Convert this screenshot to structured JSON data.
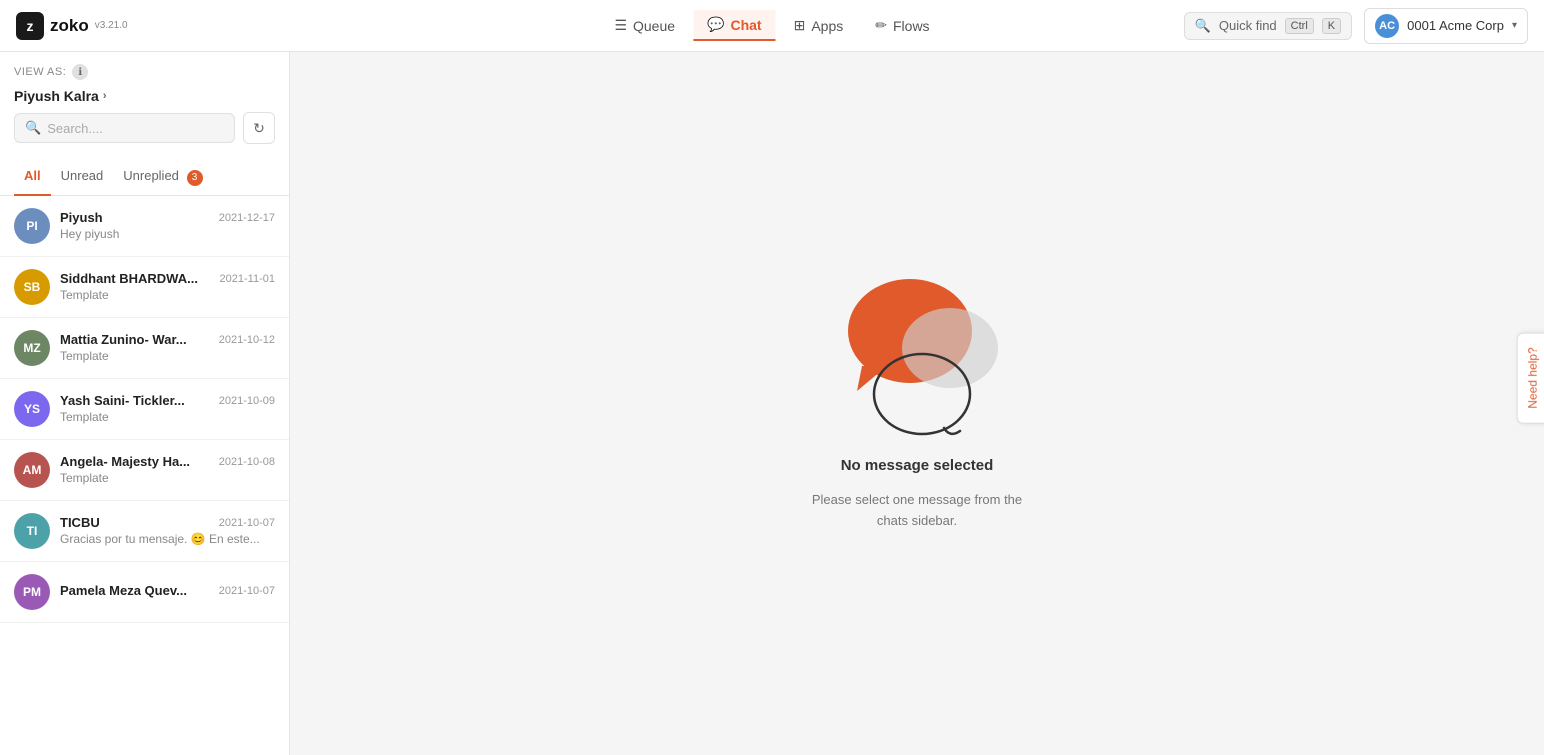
{
  "app": {
    "logo_text": "z",
    "logo_name": "zoko",
    "logo_version": "v3.21.0"
  },
  "nav": {
    "items": [
      {
        "id": "queue",
        "label": "Queue",
        "icon": "☰",
        "active": false
      },
      {
        "id": "chat",
        "label": "Chat",
        "icon": "💬",
        "active": true
      },
      {
        "id": "apps",
        "label": "Apps",
        "icon": "⊞",
        "active": false
      },
      {
        "id": "flows",
        "label": "Flows",
        "icon": "✏",
        "active": false
      }
    ],
    "quick_find_label": "Quick find",
    "kbd_ctrl": "Ctrl",
    "kbd_k": "K",
    "account_name": "0001 Acme Corp",
    "account_initials": "AC"
  },
  "sidebar": {
    "view_as_label": "VIEW AS:",
    "user_name": "Piyush Kalra",
    "search_placeholder": "Search....",
    "tabs": [
      {
        "id": "all",
        "label": "All",
        "active": true,
        "badge": null
      },
      {
        "id": "unread",
        "label": "Unread",
        "active": false,
        "badge": null
      },
      {
        "id": "unreplied",
        "label": "Unreplied",
        "active": false,
        "badge": 3
      }
    ],
    "chats": [
      {
        "id": "piyush",
        "initials": "PI",
        "avatar_color": "#6c8ebf",
        "name": "Piyush",
        "date": "2021-12-17",
        "preview": "Hey piyush"
      },
      {
        "id": "siddhant",
        "initials": "SB",
        "avatar_color": "#d79b00",
        "name": "Siddhant BHARDWA...",
        "date": "2021-11-01",
        "preview": "Template"
      },
      {
        "id": "mattia",
        "initials": "MZ",
        "avatar_color": "#6d8764",
        "name": "Mattia Zunino- War...",
        "date": "2021-10-12",
        "preview": "Template"
      },
      {
        "id": "yash",
        "initials": "YS",
        "avatar_color": "#7b68ee",
        "name": "Yash Saini- Tickler...",
        "date": "2021-10-09",
        "preview": "Template"
      },
      {
        "id": "angela",
        "initials": "AM",
        "avatar_color": "#b85450",
        "name": "Angela- Majesty Ha...",
        "date": "2021-10-08",
        "preview": "Template"
      },
      {
        "id": "ticbu",
        "initials": "TI",
        "avatar_color": "#4da1a9",
        "name": "TICBU",
        "date": "2021-10-07",
        "preview": "Gracias por tu mensaje. 😊 En este..."
      },
      {
        "id": "pamela",
        "initials": "PM",
        "avatar_color": "#9b59b6",
        "name": "Pamela Meza Quev...",
        "date": "2021-10-07",
        "preview": ""
      }
    ]
  },
  "main": {
    "empty_title": "No message selected",
    "empty_sub": "Please select one message from the\nchats sidebar."
  },
  "need_help": "Need help?"
}
